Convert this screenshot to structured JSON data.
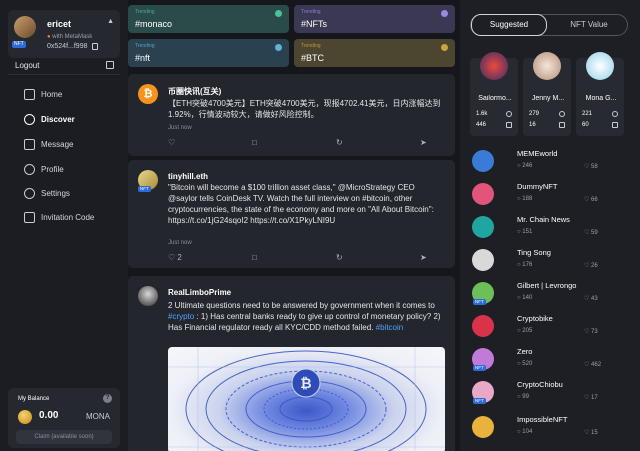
{
  "sidebar": {
    "username": "ericet",
    "with_label": "with MetaMask",
    "nft_badge": "NFT",
    "wallet": "0x524f...f998",
    "logout": "Logout",
    "nav": [
      {
        "label": "Home",
        "icon": "home-icon"
      },
      {
        "label": "Discover",
        "icon": "compass-icon"
      },
      {
        "label": "Message",
        "icon": "message-icon"
      },
      {
        "label": "Profile",
        "icon": "user-icon"
      },
      {
        "label": "Settings",
        "icon": "gear-icon"
      },
      {
        "label": "Invitation Code",
        "icon": "ticket-icon"
      }
    ],
    "balance": {
      "title": "My Balance",
      "help": "?",
      "value": "0.00",
      "unit": "MONA",
      "claim": "Claim (available soon)"
    }
  },
  "trending": [
    {
      "label": "Trending",
      "tag": "#monaco",
      "bg": "#2b4a4a",
      "accent": "#49c29a"
    },
    {
      "label": "Trending",
      "tag": "#NFTs",
      "bg": "#3a3852",
      "accent": "#9b8be0"
    },
    {
      "label": "Trending",
      "tag": "#nft",
      "bg": "#2a4150",
      "accent": "#5fb3d6"
    },
    {
      "label": "Trending",
      "tag": "#BTC",
      "bg": "#4c4631",
      "accent": "#c9a63c"
    }
  ],
  "posts": [
    {
      "author": "币圈快讯(互关)",
      "text": "【ETH突破4700美元】ETH突破4700美元，现报4702.41美元，日内涨幅达到1.92%，行情波动较大，请做好风险控制。",
      "time": "Just now",
      "likes": ""
    },
    {
      "author": "tinyhill.eth",
      "nft_badge": "NFT",
      "text": "\"Bitcoin will become a $100 trillion asset class,\" @MicroStrategy CEO @saylor tells CoinDesk TV. Watch the full interview on #bitcoin, other cryptocurrencies, the state of the economy and more on \"All About Bitcoin\": https://t.co/1jG24sqoI2 https://t.co/X1PkyLNI9U",
      "time": "Just now",
      "likes": "2"
    },
    {
      "author": "RealLimboPrime",
      "text_pre": "2 Ultimate questions need to be answered by government when it comes to ",
      "text_link1": "#crypto",
      "text_mid": " : 1) Has central banks ready to give up control of monetary policy? 2) Has Financial regulator ready all KYC/CDD method failed. ",
      "text_link2": "#bitcoin"
    }
  ],
  "right": {
    "tabs": [
      "Suggested",
      "NFT Value"
    ],
    "cards": [
      {
        "name": "Sailormo...",
        "n1": "1.6k",
        "n2": "446"
      },
      {
        "name": "Jenny M...",
        "n1": "279",
        "n2": "16"
      },
      {
        "name": "Mona G...",
        "n1": "221",
        "n2": "60"
      }
    ],
    "users": [
      {
        "name": "MEMEworld",
        "followers": "246",
        "likes": "58",
        "nft": false
      },
      {
        "name": "DummyNFT",
        "followers": "188",
        "likes": "66",
        "nft": false
      },
      {
        "name": "Mr. Chain News",
        "followers": "151",
        "likes": "59",
        "nft": false
      },
      {
        "name": "Ting Song",
        "followers": "176",
        "likes": "26",
        "nft": false
      },
      {
        "name": "Gilbert | Levrongo",
        "followers": "140",
        "likes": "43",
        "nft": true
      },
      {
        "name": "Cryptobike",
        "followers": "205",
        "likes": "73",
        "nft": false
      },
      {
        "name": "Zero",
        "followers": "520",
        "likes": "462",
        "nft": true
      },
      {
        "name": "CryptoChiobu",
        "followers": "99",
        "likes": "17",
        "nft": true
      },
      {
        "name": "ImpossibleNFT",
        "followers": "104",
        "likes": "15",
        "nft": false
      }
    ]
  }
}
